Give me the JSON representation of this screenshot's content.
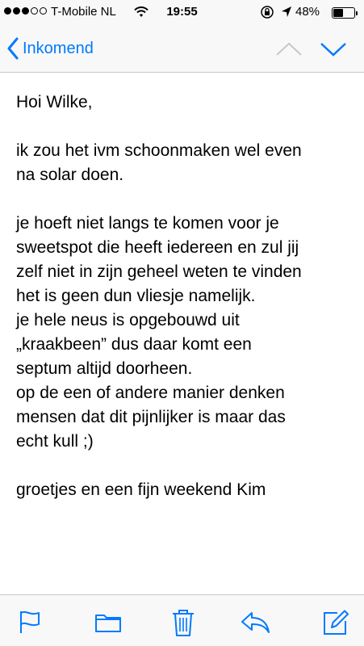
{
  "status_bar": {
    "carrier": "T-Mobile NL",
    "time": "19:55",
    "battery_percent": "48%",
    "battery_level": 0.48,
    "signal_bars_filled": 3,
    "signal_bars_total": 5
  },
  "nav": {
    "back_label": "Inkomend"
  },
  "message": {
    "greeting": "Hoi Wilke,",
    "paragraph1": [
      "ik zou het ivm schoonmaken wel even",
      "na solar doen."
    ],
    "paragraph2": [
      "je hoeft niet langs te komen voor je",
      "sweetspot die heeft iedereen en zul jij",
      "zelf niet in zijn geheel weten te vinden",
      "het is geen dun vliesje namelijk.",
      "je hele neus is opgebouwd uit",
      "„kraakbeen” dus daar komt een",
      "septum altijd doorheen.",
      "op de een of andere manier denken",
      "mensen dat dit pijnlijker is maar das",
      "echt kull ;)"
    ],
    "closing": "groetjes en een fijn weekend Kim"
  },
  "colors": {
    "accent": "#007aff",
    "disabled": "#c7c7cc",
    "bar_background": "#f8f8f8"
  },
  "toolbar": {
    "icons": [
      "flag-icon",
      "folder-icon",
      "trash-icon",
      "reply-icon",
      "compose-icon"
    ]
  }
}
